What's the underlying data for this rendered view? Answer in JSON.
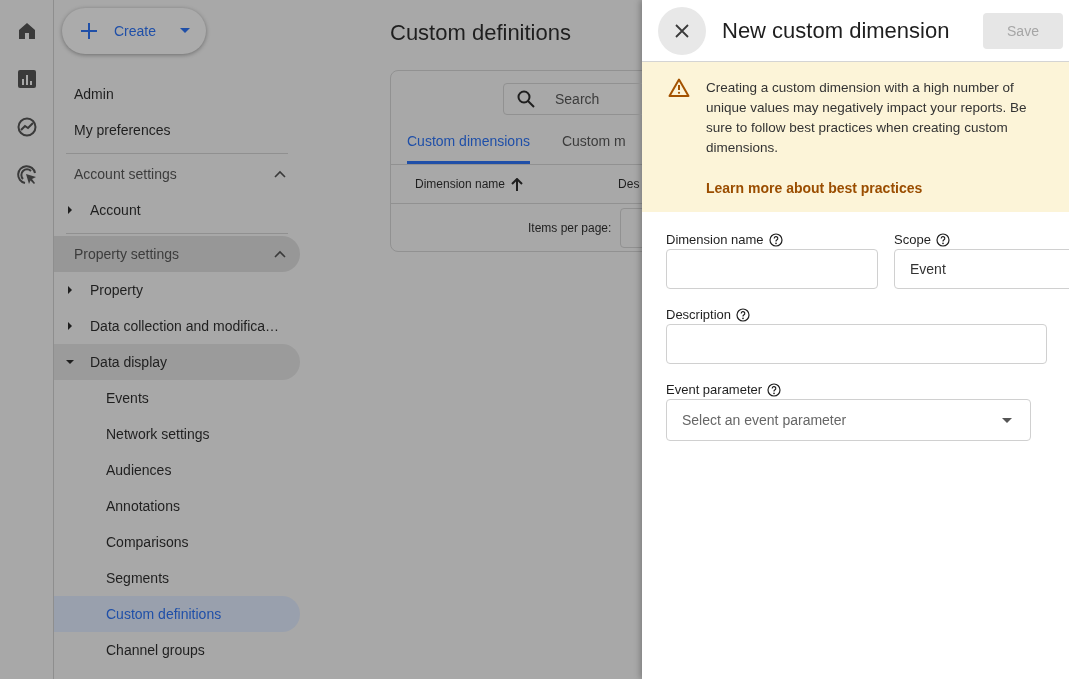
{
  "create_button": {
    "label": "Create"
  },
  "nav_top": [
    {
      "label": "Admin"
    },
    {
      "label": "My preferences"
    }
  ],
  "sections": [
    {
      "title": "Account settings",
      "expanded": true,
      "highlighted": false,
      "items": [
        {
          "label": "Account",
          "expanded": false,
          "selected": false
        }
      ]
    },
    {
      "title": "Property settings",
      "expanded": true,
      "highlighted": true,
      "items": [
        {
          "label": "Property",
          "expanded": false,
          "selected": false
        },
        {
          "label": "Data collection and modifica…",
          "expanded": false,
          "selected": false
        },
        {
          "label": "Data display",
          "expanded": true,
          "selected": true,
          "children": [
            {
              "label": "Events",
              "selected": false
            },
            {
              "label": "Network settings",
              "selected": false
            },
            {
              "label": "Audiences",
              "selected": false
            },
            {
              "label": "Annotations",
              "selected": false
            },
            {
              "label": "Comparisons",
              "selected": false
            },
            {
              "label": "Segments",
              "selected": false
            },
            {
              "label": "Custom definitions",
              "selected": true
            },
            {
              "label": "Channel groups",
              "selected": false
            }
          ]
        }
      ]
    }
  ],
  "main": {
    "title": "Custom definitions",
    "search": {
      "placeholder": "Search"
    },
    "tabs": [
      {
        "label": "Custom dimensions",
        "selected": true
      },
      {
        "label": "Custom m",
        "selected": false
      }
    ],
    "columns": [
      {
        "label": "Dimension name",
        "sorted": true
      },
      {
        "label": "Des",
        "sorted": false
      }
    ],
    "items_per_page": "Items per page:"
  },
  "panel": {
    "title": "New custom dimension",
    "save": {
      "label": "Save",
      "disabled": true
    },
    "warning": {
      "text": "Creating a custom dimension with a high number of unique values may negatively impact your reports. Be sure to follow best practices when creating custom dimensions.",
      "link": "Learn more about best practices"
    },
    "fields": [
      {
        "kind": "input",
        "label": "Dimension name"
      },
      {
        "kind": "input",
        "label": "Scope",
        "value": "Event"
      },
      {
        "kind": "input",
        "label": "Description"
      },
      {
        "kind": "select",
        "label": "Event parameter",
        "placeholder": "Select an event parameter"
      }
    ]
  }
}
